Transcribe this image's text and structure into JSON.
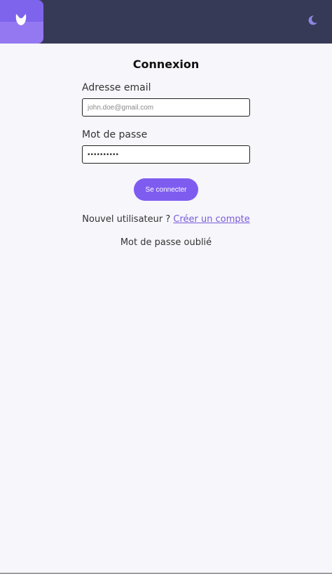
{
  "header": {
    "logo_icon": "leaf-drop-logo-icon",
    "theme_toggle_icon": "moon-icon",
    "accent_color": "#7e64ec",
    "bar_color": "#373a57"
  },
  "form": {
    "title": "Connexion",
    "email_label": "Adresse email",
    "email_placeholder": "john.doe@gmail.com",
    "password_label": "Mot de passe",
    "password_value": "••••••••••",
    "submit_label": "Se connecter",
    "new_user_text": "Nouvel utilisateur ?",
    "create_account_link": "Créer un compte",
    "forgot_password_link": "Mot de passe oublié"
  }
}
